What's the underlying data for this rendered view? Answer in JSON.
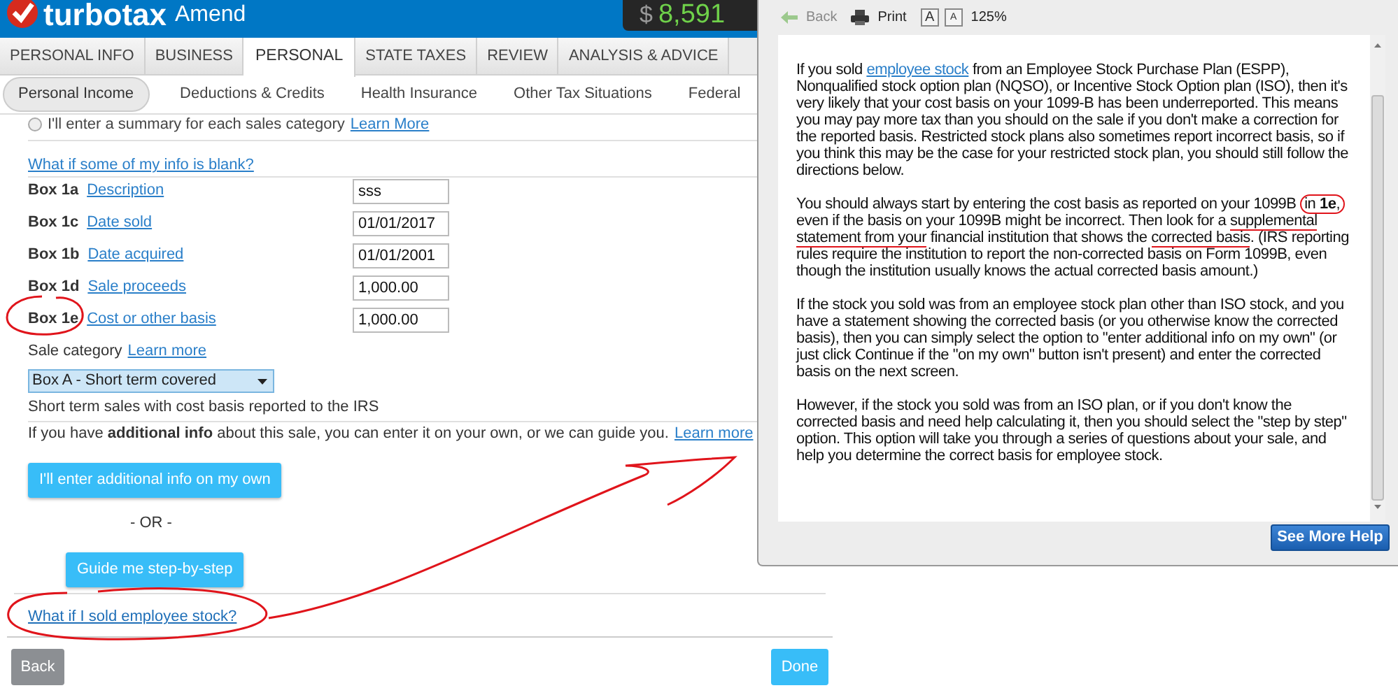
{
  "header": {
    "logo_text": "turbotax",
    "product": "Amend",
    "refund_symbol": "$",
    "refund": "8,591"
  },
  "tabs": [
    {
      "label": "PERSONAL INFO",
      "selected": false
    },
    {
      "label": "BUSINESS",
      "selected": false
    },
    {
      "label": "PERSONAL",
      "selected": true
    },
    {
      "label": "STATE TAXES",
      "selected": false
    },
    {
      "label": "REVIEW",
      "selected": false
    },
    {
      "label": "ANALYSIS & ADVICE",
      "selected": false
    }
  ],
  "subtabs": [
    {
      "label": "Personal Income",
      "selected": true
    },
    {
      "label": "Deductions & Credits",
      "selected": false
    },
    {
      "label": "Health Insurance",
      "selected": false
    },
    {
      "label": "Other Tax Situations",
      "selected": false
    },
    {
      "label": "Federal",
      "selected": false
    }
  ],
  "summary_option": {
    "label": "I'll enter a summary for each sales category",
    "link": "Learn More",
    "checked": false
  },
  "blank_info_link": "What if some of my info is blank?",
  "fields": [
    {
      "box": "Box 1a",
      "link": "Description",
      "value": "sss"
    },
    {
      "box": "Box 1c",
      "link": "Date sold",
      "value": "01/01/2017"
    },
    {
      "box": "Box 1b",
      "link": "Date acquired",
      "value": "01/01/2001"
    },
    {
      "box": "Box 1d",
      "link": "Sale proceeds",
      "value": "1,000.00"
    },
    {
      "box": "Box 1e",
      "link": "Cost or other basis",
      "value": "1,000.00"
    }
  ],
  "sale_category": {
    "label": "Sale category",
    "link": "Learn more",
    "value": "Box A - Short term covered",
    "description": "Short term sales with cost basis reported to the IRS"
  },
  "additional_info": {
    "text": "If you have **additional info** about this sale, you can enter it on your own, or we can guide you.",
    "link": "Learn more"
  },
  "own_button": "I'll enter additional info on my own",
  "or_text": "- OR -",
  "guide_button": "Guide me step-by-step",
  "employee_link": "What if I sold employee stock?",
  "back_button": "Back",
  "done_button": "Done",
  "help": {
    "toolbar": {
      "back": "Back",
      "print": "Print",
      "larger": "A",
      "smaller": "A",
      "zoom": "125%"
    },
    "paragraphs": [
      {
        "before": "If you sold ",
        "link": "employee stock",
        "after": " from an Employee Stock Purchase Plan (ESPP), Nonqualified stock option plan (NQSO), or Incentive Stock Option plan (ISO), then it's very likely that your cost basis on your 1099-B has been underreported. This means you may pay more tax than you should on the sale if you don't make a correction for the reported basis. Restricted stock plans also sometimes report incorrect basis, so if you think this may be the case for your restricted stock plan, you should still follow the directions below."
      },
      {
        "segments": [
          {
            "text": "You should always start by entering the cost basis as reported on your 1099B ",
            "kind": "plain"
          },
          {
            "text": "in **1e**,",
            "kind": "circled"
          },
          {
            "text": " even if the basis on your 1099B might be incorrect. Then look for a ",
            "kind": "plain"
          },
          {
            "text": "supplemental statement from your",
            "kind": "underlined"
          },
          {
            "text": " financial institution that shows the ",
            "kind": "plain"
          },
          {
            "text": "corrected basis",
            "kind": "underlined"
          },
          {
            "text": ". (IRS reporting rules require the institution to report the non-corrected basis on Form 1099B, even though the institution usually knows the actual corrected basis amount.)",
            "kind": "plain"
          }
        ]
      },
      {
        "text": "If the stock you sold was from an employee stock plan other than ISO stock, and you have a statement showing the corrected basis (or you otherwise know the corrected basis), then you can simply select the option to \"enter additional info on my own\" (or just click Continue if the \"on my own\" button isn't present) and enter the corrected basis on the next screen."
      },
      {
        "text": "However, if the stock you sold was from an ISO plan, or if you don't know the corrected basis and need help calculating it, then you should select the \"step by step\" option. This option will take you through a series of questions about your sale, and help you determine the correct basis for employee stock."
      }
    ],
    "more_button": "See More Help"
  }
}
